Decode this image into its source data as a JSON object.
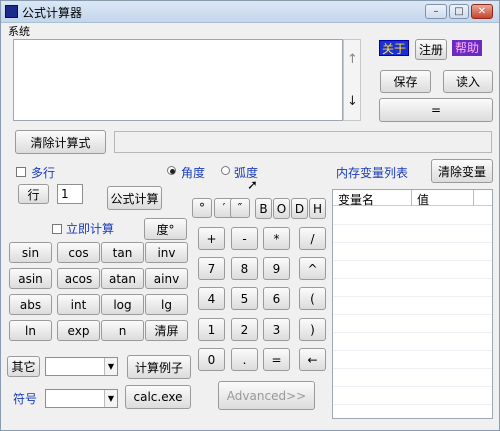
{
  "window": {
    "title": "公式计算器",
    "controls": [
      "–",
      "□",
      "✕"
    ]
  },
  "menu": {
    "system": "系统"
  },
  "top_buttons": {
    "about": "关于",
    "register": "注册",
    "help": "帮助",
    "save": "保存",
    "load": "读入",
    "equals": "="
  },
  "scroll_arrows": {
    "up": "↑",
    "down": "↓"
  },
  "clear_formula": "清除计算式",
  "options": {
    "multiline": "多行",
    "row_button": "行",
    "row_value": "1",
    "formula_calc": "公式计算",
    "instant_calc": "立即计算",
    "degree_button": "度°",
    "angle": "角度",
    "radian": "弧度",
    "angle_selected": "角度"
  },
  "variables": {
    "title": "内存变量列表",
    "clear": "清除变量",
    "col_name": "变量名",
    "col_value": "值"
  },
  "functions": [
    "sin",
    "cos",
    "tan",
    "inv",
    "asin",
    "acos",
    "atan",
    "ainv",
    "abs",
    "int",
    "log",
    "lg",
    "ln",
    "exp",
    "n",
    "清屏"
  ],
  "symbols_row": [
    "°",
    "′",
    "″"
  ],
  "base_row": [
    "B",
    "O",
    "D",
    "H"
  ],
  "keypad": [
    "+",
    "-",
    "*",
    "/",
    "7",
    "8",
    "9",
    "^",
    "4",
    "5",
    "6",
    "(",
    "1",
    "2",
    "3",
    ")",
    "0",
    ".",
    "=",
    "←"
  ],
  "bottom": {
    "other_label": "其它",
    "calc_example": "计算例子",
    "symbol_label": "符号",
    "calc_exe": "calc.exe",
    "advanced": "Advanced>>"
  }
}
